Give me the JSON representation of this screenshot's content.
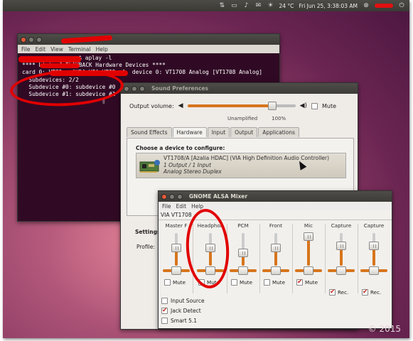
{
  "top_panel": {
    "temperature": "24 °C",
    "datetime": "Fri Jun 25,  3:38:03 AM",
    "icons": [
      "network-icon",
      "battery-icon",
      "volume-icon",
      "mail-icon",
      "weather-icon",
      "user-icon",
      "power-icon"
    ]
  },
  "terminal": {
    "title": "~",
    "menu": [
      "File",
      "Edit",
      "View",
      "Terminal",
      "Help"
    ],
    "lines": [
      ":~$ aplay -l",
      "**** List of PLAYBACK Hardware Devices ****",
      "card 0: VT82xx [HDA VIA VT82xx], device 0: VT1708 Analog [VT1708 Analog]",
      "  Subdevices: 2/2",
      "  Subdevice #0: subdevice #0",
      "  Subdevice #1: subdevice #1",
      "                        ▯"
    ]
  },
  "sound_prefs": {
    "title": "Sound Preferences",
    "output_volume_label": "Output volume:",
    "mute_label": "Mute",
    "unamplified_label": "Unamplified",
    "percent_label": "100%",
    "output_volume_level": 0.78,
    "tabs": [
      "Sound Effects",
      "Hardware",
      "Input",
      "Output",
      "Applications"
    ],
    "active_tab": "Hardware",
    "choose_label": "Choose a device to configure:",
    "device": {
      "name": "VT1708/A [Azalia HDAC] (VIA High Definition Audio Controller)",
      "io": "1 Output / 1 Input",
      "profile": "Analog Stereo Duplex"
    },
    "settings_label": "Settings",
    "profile_label": "Profile:"
  },
  "mixer": {
    "title": "GNOME ALSA Mixer",
    "menu": [
      "File",
      "Edit",
      "Help"
    ],
    "device_label": "VIA VT1708",
    "channels": [
      {
        "name": "Master F",
        "level": 0.55,
        "check_label": "Mute",
        "muted": false,
        "rec": null
      },
      {
        "name": "Headphon",
        "level": 0.55,
        "check_label": "Mute",
        "muted": false,
        "rec": null
      },
      {
        "name": "PCM",
        "level": 0.4,
        "check_label": "Mute",
        "muted": false,
        "rec": null
      },
      {
        "name": "Front",
        "level": 0.55,
        "check_label": "Mute",
        "muted": false,
        "rec": null
      },
      {
        "name": "Mic",
        "level": 0.9,
        "check_label": "Mute",
        "muted": true,
        "rec": null
      },
      {
        "name": "Capture",
        "level": 0.6,
        "check_label": "Rec.",
        "muted": false,
        "rec": true
      },
      {
        "name": "Capture",
        "level": 0.6,
        "check_label": "Rec.",
        "muted": false,
        "rec": true
      }
    ],
    "switches": [
      {
        "label": "Input Source",
        "on": false
      },
      {
        "label": "Jack Detect",
        "on": true
      },
      {
        "label": "Smart 5.1",
        "on": false
      }
    ]
  },
  "copyright": "© 2015"
}
